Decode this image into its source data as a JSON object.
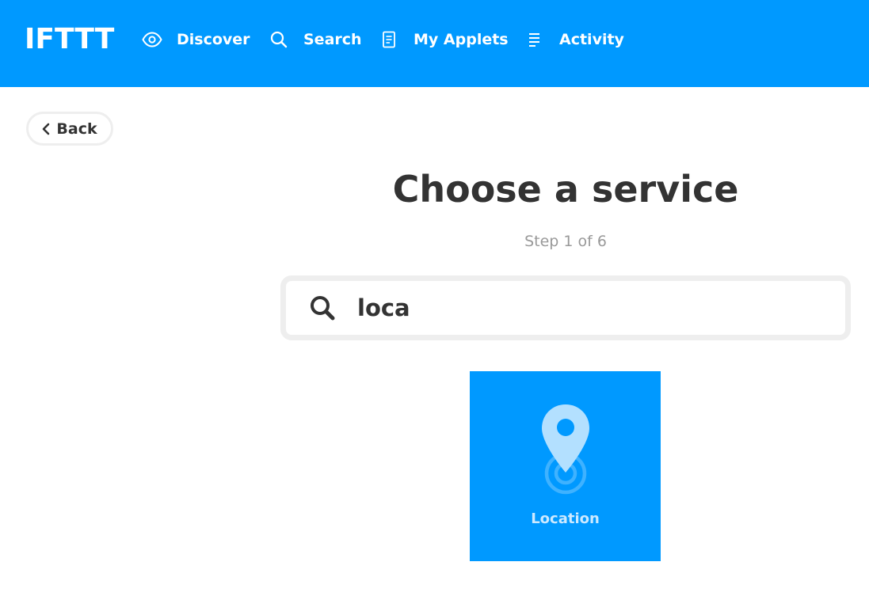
{
  "brand": {
    "logo": "IFTTT"
  },
  "nav": {
    "discover": {
      "label": "Discover",
      "icon": "eye-icon"
    },
    "search": {
      "label": "Search",
      "icon": "search-icon"
    },
    "applets": {
      "label": "My Applets",
      "icon": "document-icon"
    },
    "activity": {
      "label": "Activity",
      "icon": "list-icon"
    }
  },
  "back": {
    "label": "Back",
    "icon": "chevron-left-icon"
  },
  "header": {
    "title": "Choose a service",
    "step": "Step 1 of 6"
  },
  "search": {
    "value": "loca",
    "icon": "search-icon"
  },
  "results": [
    {
      "label": "Location",
      "icon": "location-pin-icon"
    }
  ],
  "colors": {
    "brand_blue": "#0099ff",
    "text_dark": "#333333",
    "text_muted": "#999999",
    "border_light": "#eeeeee"
  }
}
